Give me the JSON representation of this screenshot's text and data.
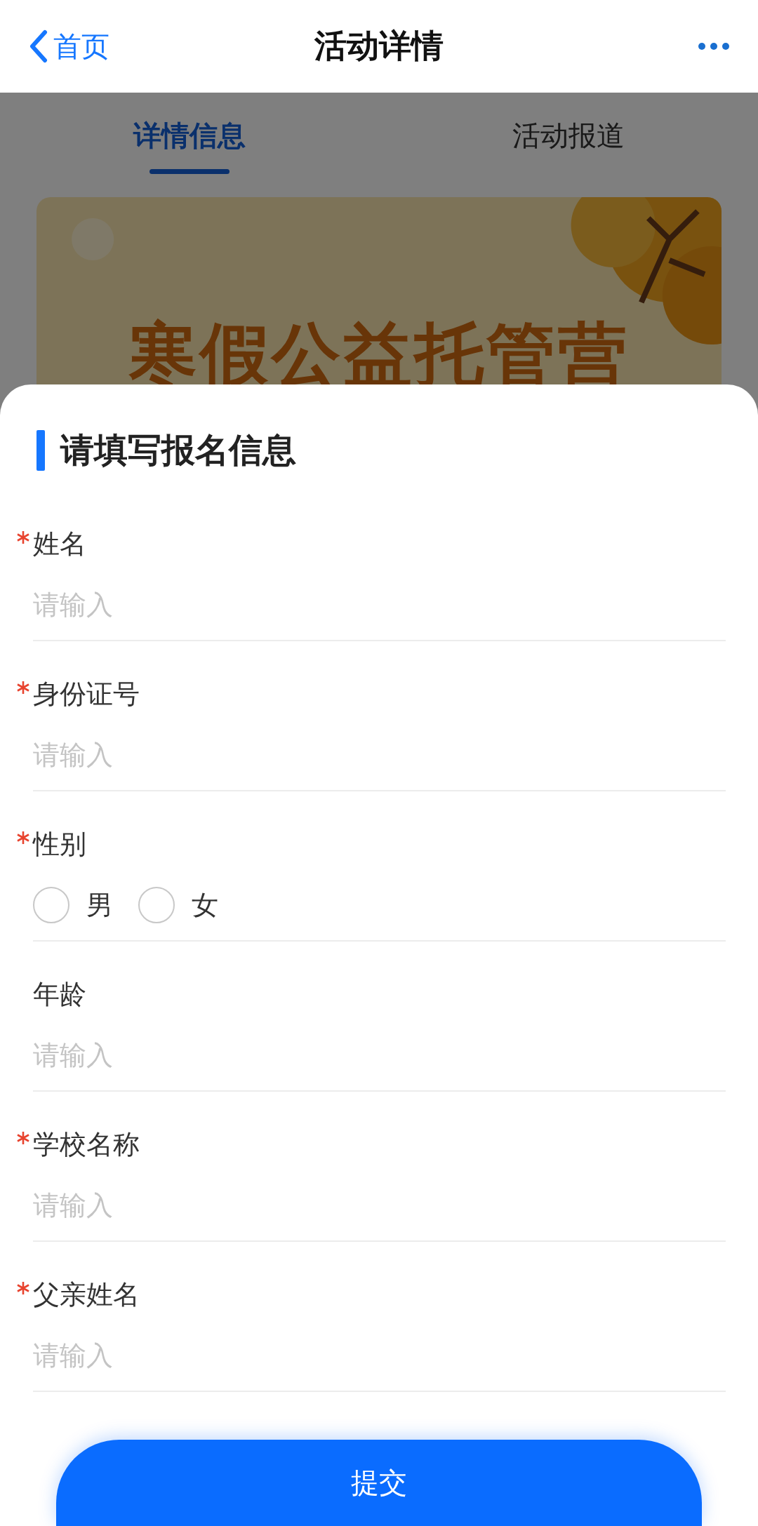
{
  "header": {
    "back_label": "首页",
    "title": "活动详情"
  },
  "tabs": [
    {
      "label": "详情信息",
      "selected": true
    },
    {
      "label": "活动报道",
      "selected": false
    }
  ],
  "banner": {
    "kind": "picture",
    "title": "寒假公益托管营"
  },
  "form": {
    "title": "请填写报名信息",
    "fields": [
      {
        "kind": "text",
        "label": "姓名",
        "required": true,
        "placeholder": "请输入"
      },
      {
        "kind": "text",
        "label": "身份证号",
        "required": true,
        "placeholder": "请输入"
      },
      {
        "kind": "radio",
        "label": "性别",
        "required": true,
        "options": [
          {
            "label": "男",
            "selected": false
          },
          {
            "label": "女",
            "selected": false
          }
        ]
      },
      {
        "kind": "text",
        "label": "年龄",
        "required": false,
        "placeholder": "请输入"
      },
      {
        "kind": "text",
        "label": "学校名称",
        "required": true,
        "placeholder": "请输入"
      },
      {
        "kind": "text",
        "label": "父亲姓名",
        "required": true,
        "placeholder": "请输入"
      }
    ]
  },
  "submit": "提交"
}
